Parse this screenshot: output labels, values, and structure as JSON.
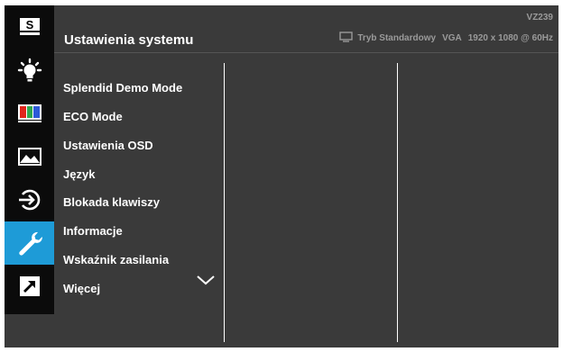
{
  "header": {
    "title": "Ustawienia systemu",
    "model": "VZ239",
    "mode": "Tryb Standardowy",
    "input": "VGA",
    "resolution": "1920 x 1080 @ 60Hz"
  },
  "sidebar": {
    "items": [
      {
        "icon": "splendid-s-icon",
        "label": "S",
        "active": false
      },
      {
        "icon": "bluelight-bulb-icon",
        "active": false
      },
      {
        "icon": "color-bars-icon",
        "active": false
      },
      {
        "icon": "image-landscape-icon",
        "active": false
      },
      {
        "icon": "input-select-icon",
        "active": false
      },
      {
        "icon": "wrench-icon",
        "active": true
      },
      {
        "icon": "shortcut-arrow-icon",
        "active": false
      }
    ]
  },
  "menu": {
    "items": [
      "Splendid Demo Mode",
      "ECO Mode",
      "Ustawienia OSD",
      "Język",
      "Blokada klawiszy",
      "Informacje",
      "Wskaźnik zasilania",
      "Więcej"
    ]
  },
  "colors": {
    "accent": "#1e9bd7",
    "panel": "#3a3a3a",
    "rail": "#0b0b0b",
    "text": "#ffffff",
    "muted": "#9a9a9a"
  }
}
